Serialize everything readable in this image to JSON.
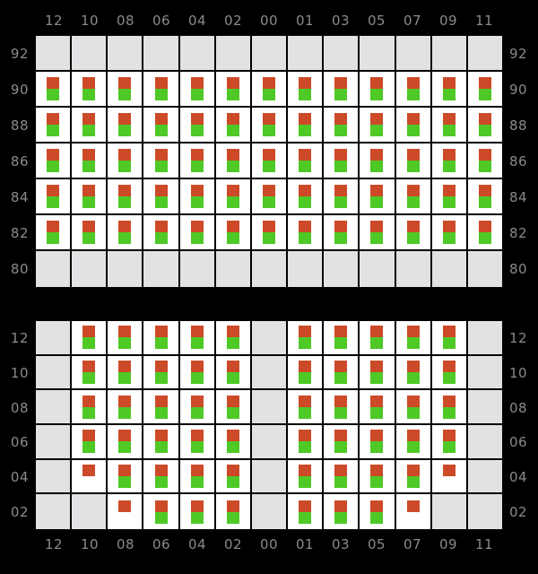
{
  "colors": {
    "background": "#000000",
    "cell_empty": "#e2e2e5",
    "cell_filled": "#ffffff",
    "mark_red": "#cc4a28",
    "mark_green": "#4ec926",
    "axis_text": "#8a8a8a"
  },
  "chart_data": [
    {
      "id": "top",
      "type": "heatmap",
      "title": "",
      "xlabel": "",
      "ylabel": "",
      "grid": true,
      "legend": "none",
      "x_axis_position": "top",
      "y_axis_position": "both",
      "categories": [
        "12",
        "10",
        "08",
        "06",
        "04",
        "02",
        "00",
        "01",
        "03",
        "05",
        "07",
        "09",
        "11"
      ],
      "row_labels": [
        "92",
        "90",
        "88",
        "86",
        "84",
        "82",
        "80"
      ],
      "cell_states": [
        [
          "empty",
          "empty",
          "empty",
          "empty",
          "empty",
          "empty",
          "empty",
          "empty",
          "empty",
          "empty",
          "empty",
          "empty",
          "empty"
        ],
        [
          "both",
          "both",
          "both",
          "both",
          "both",
          "both",
          "both",
          "both",
          "both",
          "both",
          "both",
          "both",
          "both"
        ],
        [
          "both",
          "both",
          "both",
          "both",
          "both",
          "both",
          "both",
          "both",
          "both",
          "both",
          "both",
          "both",
          "both"
        ],
        [
          "both",
          "both",
          "both",
          "both",
          "both",
          "both",
          "both",
          "both",
          "both",
          "both",
          "both",
          "both",
          "both"
        ],
        [
          "both",
          "both",
          "both",
          "both",
          "both",
          "both",
          "both",
          "both",
          "both",
          "both",
          "both",
          "both",
          "both"
        ],
        [
          "both",
          "both",
          "both",
          "both",
          "both",
          "both",
          "both",
          "both",
          "both",
          "both",
          "both",
          "both",
          "both"
        ],
        [
          "empty",
          "empty",
          "empty",
          "empty",
          "empty",
          "empty",
          "empty",
          "empty",
          "empty",
          "empty",
          "empty",
          "empty",
          "empty"
        ]
      ]
    },
    {
      "id": "bottom",
      "type": "heatmap",
      "title": "",
      "xlabel": "",
      "ylabel": "",
      "grid": true,
      "legend": "none",
      "x_axis_position": "bottom",
      "y_axis_position": "both",
      "categories": [
        "12",
        "10",
        "08",
        "06",
        "04",
        "02",
        "00",
        "01",
        "03",
        "05",
        "07",
        "09",
        "11"
      ],
      "row_labels": [
        "12",
        "10",
        "08",
        "06",
        "04",
        "02"
      ],
      "cell_states": [
        [
          "empty",
          "both",
          "both",
          "both",
          "both",
          "both",
          "empty",
          "both",
          "both",
          "both",
          "both",
          "both",
          "empty"
        ],
        [
          "empty",
          "both",
          "both",
          "both",
          "both",
          "both",
          "empty",
          "both",
          "both",
          "both",
          "both",
          "both",
          "empty"
        ],
        [
          "empty",
          "both",
          "both",
          "both",
          "both",
          "both",
          "empty",
          "both",
          "both",
          "both",
          "both",
          "both",
          "empty"
        ],
        [
          "empty",
          "both",
          "both",
          "both",
          "both",
          "both",
          "empty",
          "both",
          "both",
          "both",
          "both",
          "both",
          "empty"
        ],
        [
          "empty",
          "red",
          "both",
          "both",
          "both",
          "both",
          "empty",
          "both",
          "both",
          "both",
          "both",
          "red",
          "empty"
        ],
        [
          "empty",
          "empty",
          "red",
          "both",
          "both",
          "both",
          "empty",
          "both",
          "both",
          "both",
          "red",
          "empty",
          "empty"
        ]
      ]
    }
  ]
}
